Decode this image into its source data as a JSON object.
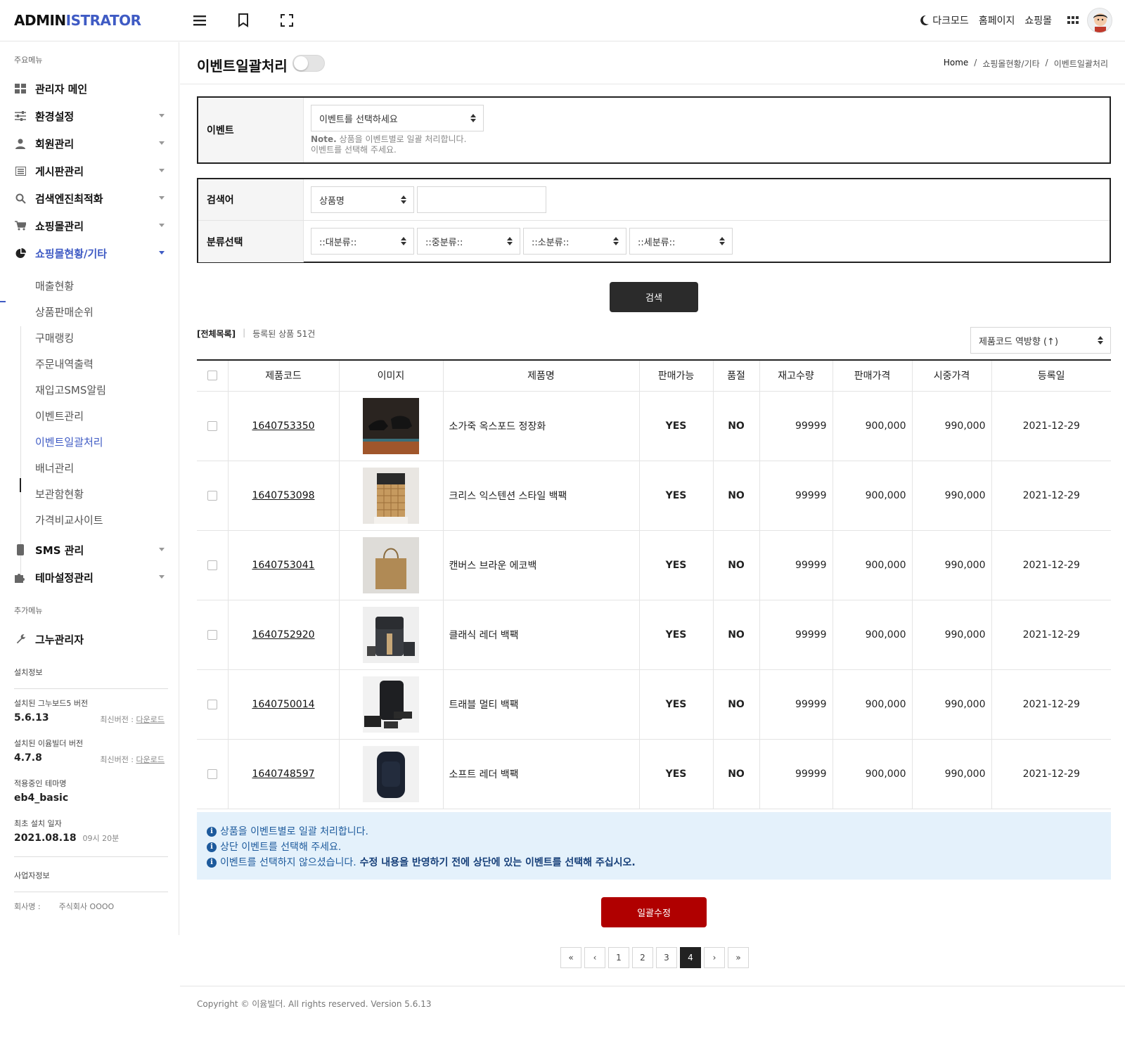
{
  "header": {
    "logo_main": "ADMIN",
    "logo_accent": "ISTRATOR",
    "dark_mode": "다크모드",
    "homepage": "홈페이지",
    "shop": "쇼핑몰"
  },
  "sidebar": {
    "main_label": "주요메뉴",
    "items": [
      {
        "label": "관리자 메인",
        "icon": "dashboard-icon"
      },
      {
        "label": "환경설정",
        "icon": "sliders-icon"
      },
      {
        "label": "회원관리",
        "icon": "user-icon"
      },
      {
        "label": "게시판관리",
        "icon": "board-icon"
      },
      {
        "label": "검색엔진최적화",
        "icon": "search-icon"
      },
      {
        "label": "쇼핑몰관리",
        "icon": "cart-icon"
      },
      {
        "label": "쇼핑몰현황/기타",
        "icon": "pie-chart-icon"
      }
    ],
    "sub_items": [
      "매출현황",
      "상품판매순위",
      "구매랭킹",
      "주문내역출력",
      "재입고SMS알림",
      "이벤트관리",
      "이벤트일괄처리",
      "배너관리",
      "보관함현황",
      "가격비교사이트"
    ],
    "items2": [
      {
        "label": "SMS 관리",
        "icon": "mobile-icon"
      },
      {
        "label": "테마설정관리",
        "icon": "puzzle-icon"
      }
    ],
    "extra_label": "추가메뉴",
    "extra_item": "그누관리자",
    "install_label": "설치정보",
    "gnuboard_title": "설치된 그누보드5 버전",
    "gnuboard_version": "5.6.13",
    "latest_label": "최신버전 :",
    "download": "다운로드",
    "eyoom_title": "설치된 이윰빌더 버전",
    "eyoom_version": "4.7.8",
    "theme_title": "적용중인 테마명",
    "theme_name": "eb4_basic",
    "install_date_title": "최초 설치 일자",
    "install_date": "2021.08.18",
    "install_time": "09시 20분",
    "biz_label": "사업자정보",
    "company_key": "회사명 :",
    "company_val": "주식회사 OOOO"
  },
  "page": {
    "title": "이벤트일괄처리",
    "breadcrumb": [
      "Home",
      "/",
      "쇼핑몰현황/기타",
      "/",
      "이벤트일괄처리"
    ]
  },
  "event_form": {
    "label": "이벤트",
    "select_value": "이벤트를 선택하세요",
    "note_bold": "Note.",
    "note_line1": " 상품을 이벤트별로 일괄 처리합니다.",
    "note_line2": "이벤트를 선택해 주세요."
  },
  "search_form": {
    "keyword_label": "검색어",
    "keyword_type": "상품명",
    "keyword_value": "",
    "category_label": "분류선택",
    "categories": [
      "::대분류::",
      "::중분류::",
      "::소분류::",
      "::세분류::"
    ],
    "search_button": "검색"
  },
  "list": {
    "all_label": "[전체목록]",
    "sep": "|",
    "count_text": "등록된 상품 51건",
    "sort_value": "제품코드 역방향 (↑)",
    "columns": [
      "제품코드",
      "이미지",
      "제품명",
      "판매가능",
      "품절",
      "재고수량",
      "판매가격",
      "시중가격",
      "등록일"
    ],
    "rows": [
      {
        "code": "1640753350",
        "name": "소가죽 옥스포드 정장화",
        "sale": "YES",
        "soldout": "NO",
        "stock": "99999",
        "price": "900,000",
        "market": "990,000",
        "date": "2021-12-29",
        "image": "shoes-image"
      },
      {
        "code": "1640753098",
        "name": "크리스 익스텐션 스타일 백팩",
        "sale": "YES",
        "soldout": "NO",
        "stock": "99999",
        "price": "900,000",
        "market": "990,000",
        "date": "2021-12-29",
        "image": "woven-backpack-image"
      },
      {
        "code": "1640753041",
        "name": "캔버스 브라운 에코백",
        "sale": "YES",
        "soldout": "NO",
        "stock": "99999",
        "price": "900,000",
        "market": "990,000",
        "date": "2021-12-29",
        "image": "ecobag-image"
      },
      {
        "code": "1640752920",
        "name": "클래식 레더 백팩",
        "sale": "YES",
        "soldout": "NO",
        "stock": "99999",
        "price": "900,000",
        "market": "990,000",
        "date": "2021-12-29",
        "image": "leather-backpack-image"
      },
      {
        "code": "1640750014",
        "name": "트래블 멀티 백팩",
        "sale": "YES",
        "soldout": "NO",
        "stock": "99999",
        "price": "900,000",
        "market": "990,000",
        "date": "2021-12-29",
        "image": "travel-backpack-image"
      },
      {
        "code": "1640748597",
        "name": "소프트 레더 백팩",
        "sale": "YES",
        "soldout": "NO",
        "stock": "99999",
        "price": "900,000",
        "market": "990,000",
        "date": "2021-12-29",
        "image": "soft-backpack-image"
      }
    ]
  },
  "notice": {
    "line1": "상품을 이벤트별로 일괄 처리합니다.",
    "line2": "상단 이벤트를 선택해 주세요.",
    "line3": "이벤트를 선택하지 않으셨습니다.",
    "line3_bold": "수정 내용을 반영하기 전에 상단에 있는 이벤트를 선택해 주십시오."
  },
  "bulk_button": "일괄수정",
  "pagination": {
    "first": "«",
    "prev": "‹",
    "pages": [
      "1",
      "2",
      "3",
      "4"
    ],
    "active": "4",
    "next": "›",
    "last": "»"
  },
  "footer": "Copyright © 이윰빌더. All rights reserved. Version 5.6.13",
  "colors": {
    "accent": "#3f5bc4",
    "yes": "#1a8a6b",
    "danger": "#b00000",
    "notice_bg": "#e4f1fb"
  }
}
